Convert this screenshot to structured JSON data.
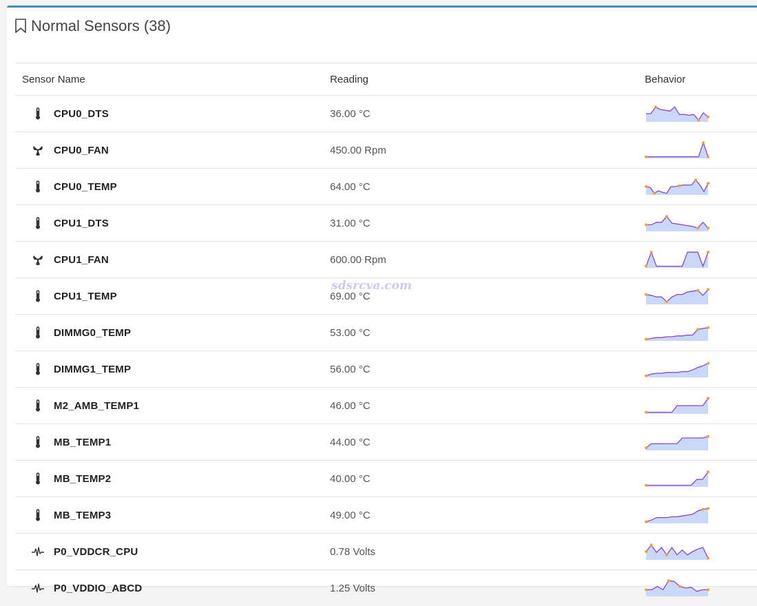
{
  "panel": {
    "title": "Normal Sensors (38)",
    "icon": "bookmark-icon"
  },
  "columns": {
    "name": "Sensor Name",
    "reading": "Reading",
    "behavior": "Behavior"
  },
  "colors": {
    "accent": "#3c8dbc",
    "spark_line": "#8b45c8",
    "spark_fill": "#c8d8f6",
    "spark_point": "#f39c3c"
  },
  "watermark": "sdsrcva.com",
  "sensors": [
    {
      "name": "CPU0_DTS",
      "reading": "36.00 °C",
      "icon": "thermometer-icon",
      "spark": [
        0.5,
        0.5,
        0.9,
        0.75,
        0.7,
        0.65,
        0.9,
        0.45,
        0.45,
        0.4,
        0.45,
        0.1,
        0.55,
        0.3
      ],
      "marks": [
        2,
        11,
        13
      ]
    },
    {
      "name": "CPU0_FAN",
      "reading": "450.00 Rpm",
      "icon": "fan-icon",
      "spark": [
        0.1,
        0.1,
        0.1,
        0.1,
        0.1,
        0.1,
        0.1,
        0.1,
        0.1,
        0.1,
        0.1,
        0.1,
        0.95,
        0.1
      ],
      "marks": [
        0,
        12,
        13
      ]
    },
    {
      "name": "CPU0_TEMP",
      "reading": "64.00 °C",
      "icon": "thermometer-icon",
      "spark": [
        0.5,
        0.45,
        0.1,
        0.25,
        0.15,
        0.1,
        0.5,
        0.5,
        0.55,
        0.6,
        0.6,
        0.6,
        0.9,
        0.6,
        0.2,
        0.7
      ],
      "marks": [
        0,
        2,
        8,
        12,
        15
      ]
    },
    {
      "name": "CPU1_DTS",
      "reading": "31.00 °C",
      "icon": "thermometer-icon",
      "spark": [
        0.4,
        0.4,
        0.55,
        0.55,
        0.9,
        0.5,
        0.45,
        0.4,
        0.35,
        0.3,
        0.2,
        0.55,
        0.2
      ],
      "marks": [
        0,
        4,
        10,
        12
      ]
    },
    {
      "name": "CPU1_FAN",
      "reading": "600.00 Rpm",
      "icon": "fan-icon",
      "spark": [
        0.1,
        0.95,
        0.1,
        0.1,
        0.1,
        0.1,
        0.1,
        0.1,
        0.95,
        0.95,
        0.95,
        0.1,
        0.95
      ],
      "marks": [
        0,
        1,
        12
      ]
    },
    {
      "name": "CPU1_TEMP",
      "reading": "69.00 °C",
      "icon": "thermometer-icon",
      "spark": [
        0.6,
        0.55,
        0.45,
        0.45,
        0.15,
        0.45,
        0.6,
        0.6,
        0.75,
        0.8,
        0.85,
        0.55,
        0.9
      ],
      "marks": [
        0,
        4,
        10,
        12
      ]
    },
    {
      "name": "DIMMG0_TEMP",
      "reading": "53.00 °C",
      "icon": "thermometer-icon",
      "spark": [
        0.1,
        0.15,
        0.2,
        0.2,
        0.25,
        0.25,
        0.3,
        0.3,
        0.35,
        0.35,
        0.7,
        0.75,
        0.8
      ],
      "marks": [
        0,
        10,
        12
      ]
    },
    {
      "name": "DIMMG1_TEMP",
      "reading": "56.00 °C",
      "icon": "thermometer-icon",
      "spark": [
        0.1,
        0.2,
        0.25,
        0.25,
        0.3,
        0.3,
        0.3,
        0.35,
        0.35,
        0.45,
        0.6,
        0.7,
        0.85
      ],
      "marks": [
        0,
        12
      ]
    },
    {
      "name": "M2_AMB_TEMP1",
      "reading": "46.00 °C",
      "icon": "thermometer-icon",
      "spark": [
        0.1,
        0.1,
        0.1,
        0.1,
        0.1,
        0.1,
        0.5,
        0.5,
        0.5,
        0.5,
        0.5,
        0.5,
        0.95
      ],
      "marks": [
        0,
        12
      ]
    },
    {
      "name": "MB_TEMP1",
      "reading": "44.00 °C",
      "icon": "thermometer-icon",
      "spark": [
        0.15,
        0.4,
        0.4,
        0.4,
        0.4,
        0.4,
        0.4,
        0.75,
        0.75,
        0.75,
        0.75,
        0.75,
        0.85
      ],
      "marks": [
        0,
        12
      ]
    },
    {
      "name": "MB_TEMP2",
      "reading": "40.00 °C",
      "icon": "thermometer-icon",
      "spark": [
        0.1,
        0.1,
        0.1,
        0.1,
        0.1,
        0.1,
        0.1,
        0.1,
        0.1,
        0.45,
        0.45,
        0.9
      ],
      "marks": [
        0,
        11
      ]
    },
    {
      "name": "MB_TEMP3",
      "reading": "49.00 °C",
      "icon": "thermometer-icon",
      "spark": [
        0.1,
        0.2,
        0.35,
        0.35,
        0.35,
        0.4,
        0.4,
        0.45,
        0.5,
        0.55,
        0.75,
        0.85,
        0.9
      ],
      "marks": [
        0,
        11,
        12
      ]
    },
    {
      "name": "P0_VDDCR_CPU",
      "reading": "0.78 Volts",
      "icon": "pulse-icon",
      "spark": [
        0.5,
        0.9,
        0.45,
        0.75,
        0.3,
        0.75,
        0.3,
        0.6,
        0.3,
        0.5,
        0.65,
        0.75,
        0.1
      ],
      "marks": [
        0,
        1,
        4,
        12
      ]
    },
    {
      "name": "P0_VDDIO_ABCD",
      "reading": "1.25 Volts",
      "icon": "pulse-icon",
      "spark": [
        0.4,
        0.4,
        0.6,
        0.4,
        0.95,
        0.9,
        0.6,
        0.5,
        0.55,
        0.3,
        0.4,
        0.4
      ],
      "marks": [
        0,
        4,
        6,
        11
      ]
    }
  ]
}
